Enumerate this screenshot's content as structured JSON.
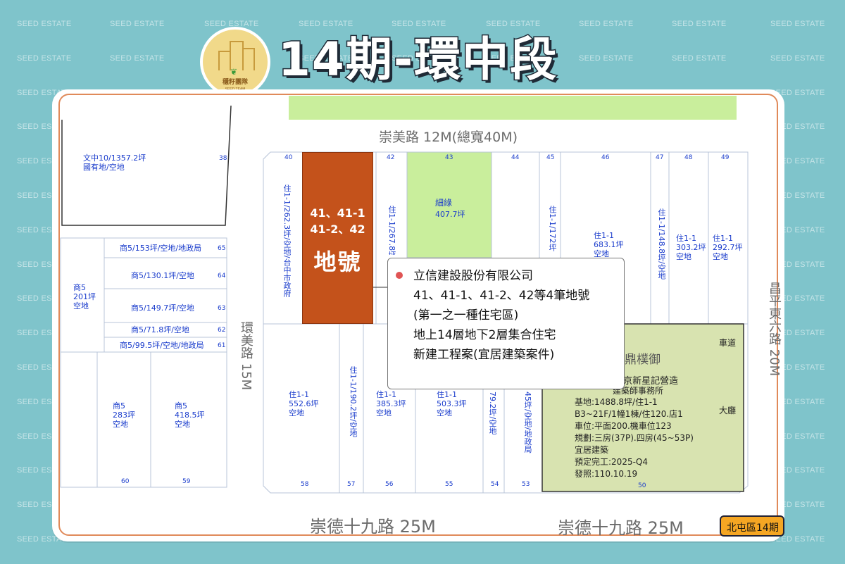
{
  "watermark": "SEED ESTATE",
  "logo": {
    "name": "穩籽團隊",
    "subname": "SEED TEAM",
    "icon": "building-sprout-icon"
  },
  "title": "14期-環中段",
  "roads": {
    "north": "崇美路 12M(總寬40M)",
    "west": "環美路 15M",
    "east": "昌平東六路 20M",
    "south_left": "崇德十九路 25M",
    "south_right": "崇德十九路 25M"
  },
  "parcels": {
    "p38": {
      "num": "38",
      "text": [
        "文中10/1357.2坪",
        "國有地/空地"
      ]
    },
    "p65": {
      "num": "65",
      "text": "商5/153坪/空地/地政局"
    },
    "p64": {
      "num": "64",
      "text": "商5/130.1坪/空地"
    },
    "p63": {
      "num": "63",
      "text": "商5/149.7坪/空地"
    },
    "p62": {
      "num": "62",
      "text": "商5/71.8坪/空地"
    },
    "p61": {
      "num": "61",
      "text": "商5/99.5坪/空地/地政局"
    },
    "p_west": {
      "text": [
        "商5",
        "201坪",
        "空地"
      ]
    },
    "p60": {
      "num": "60",
      "text": [
        "商5",
        "283坪",
        "空地"
      ]
    },
    "p59": {
      "num": "59",
      "text": [
        "商5",
        "418.5坪",
        "空地"
      ]
    },
    "p40": {
      "num": "40",
      "text": "住1-1/262.3坪/空地/台中市政府"
    },
    "p42": {
      "num": "42",
      "text": "住1-1/267.8坪"
    },
    "p43": {
      "num": "43",
      "text": [
        "細綠",
        "407.7坪"
      ]
    },
    "p44": {
      "num": "44"
    },
    "p45": {
      "num": "45",
      "text": "住1-1/172坪"
    },
    "p46": {
      "num": "46",
      "text": [
        "住1-1",
        "683.1坪",
        "空地"
      ]
    },
    "p47": {
      "num": "47",
      "text": "住1-1/148.8坪/空地"
    },
    "p48": {
      "num": "48",
      "text": [
        "住1-1",
        "303.2坪",
        "空地"
      ]
    },
    "p49": {
      "num": "49",
      "text": [
        "住1-1",
        "292.7坪",
        "空地"
      ]
    },
    "p58": {
      "num": "58",
      "text": [
        "住1-1",
        "552.6坪",
        "空地"
      ]
    },
    "p57": {
      "num": "57",
      "text": "住1-1/190.2坪/空地"
    },
    "p56": {
      "num": "56",
      "text": [
        "住1-1",
        "385.3坪",
        "空地"
      ]
    },
    "p55": {
      "num": "55",
      "text": [
        "住1-1",
        "503.3坪",
        "空地"
      ]
    },
    "p54": {
      "num": "54",
      "text": "79.2坪/空地"
    },
    "p53": {
      "num": "53",
      "text": "45坪/空地/地政局"
    },
    "p50": {
      "num": "50"
    }
  },
  "highlight_lot": {
    "line1": "41、41-1",
    "line2": "41-2、42",
    "line3": "地號",
    "color": "#c4521b"
  },
  "info_box": {
    "lines": [
      "立信建設股份有限公司",
      "41、41-1、41-2、42等4筆地號",
      "(第一之一種住宅區)",
      "地上14層地下2層集合住宅",
      "新建工程案(宜居建築案件)"
    ],
    "bullet_color": "#e05454"
  },
  "project": {
    "name": "林鼎樸御",
    "builder": "林鼎實業 南京新星記營造",
    "architect": "建築師事務所",
    "site": "基地:1488.8坪/住1-1",
    "floors": "B3~21F/1幢1棟/住120.店1",
    "parking": "車位:平面200.機車位123",
    "plan": "規劃:三房(37P).四房(45~53P)",
    "type": "宜居建築",
    "completion": "預定完工:2025-Q4",
    "permit": "發照:110.10.19",
    "driveway": "車道",
    "lobby": "大廳",
    "tag": "宜居",
    "color": "#d8e3b0"
  },
  "district_badge": "北屯區14期"
}
